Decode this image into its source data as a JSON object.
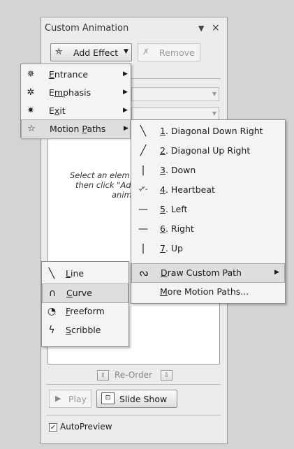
{
  "pane": {
    "title": "Custom Animation",
    "dropdown_glyph": "▼",
    "close_glyph": "×",
    "add_effect": {
      "label": "Add Effect",
      "icon": "add-effect-star-icon",
      "arrow": "▼"
    },
    "remove": {
      "label": "Remove",
      "icon": "remove-star-icon"
    },
    "list_hint": [
      "Select an elem",
      "then click \"Ad",
      "anim"
    ],
    "reorder": {
      "label": "Re-Order",
      "up_glyph": "⇧",
      "down_glyph": "⇩"
    },
    "play": {
      "label": "Play",
      "glyph": "▶"
    },
    "slide_show": {
      "label": "Slide Show",
      "glyph": "⊡"
    },
    "autopreview": {
      "label": "AutoPreview",
      "checked": true,
      "check_glyph": "✓"
    }
  },
  "effect_menu": {
    "items": [
      {
        "pre": "",
        "key": "E",
        "post": "ntrance",
        "icon": "✵"
      },
      {
        "pre": "E",
        "key": "m",
        "post": "phasis",
        "icon": "✲"
      },
      {
        "pre": "E",
        "key": "x",
        "post": "it",
        "icon": "✷"
      },
      {
        "pre": "Motion ",
        "key": "P",
        "post": "aths",
        "icon": "☆"
      }
    ],
    "submenu_arrow": "▶"
  },
  "motion_paths_menu": {
    "items": [
      {
        "key": "1",
        "rest": ". Diagonal Down Right",
        "icon": "╲"
      },
      {
        "key": "2",
        "rest": ". Diagonal Up Right",
        "icon": "╱"
      },
      {
        "key": "3",
        "rest": ". Down",
        "icon": "|"
      },
      {
        "key": "4",
        "rest": ". Heartbeat",
        "icon": "-⁄ᐟ-"
      },
      {
        "key": "5",
        "rest": ". Left",
        "icon": "—"
      },
      {
        "key": "6",
        "rest": ". Right",
        "icon": "—"
      },
      {
        "key": "7",
        "rest": ". Up",
        "icon": "|"
      },
      {
        "key": "D",
        "rest": "raw Custom Path",
        "icon": "ᔓ"
      },
      {
        "key": "M",
        "rest": "ore Motion Paths...",
        "icon": ""
      }
    ],
    "submenu_arrow": "▶"
  },
  "draw_custom_menu": {
    "items": [
      {
        "key": "L",
        "rest": "ine",
        "icon": "╲"
      },
      {
        "key": "C",
        "rest": "urve",
        "icon": "∩"
      },
      {
        "key": "F",
        "rest": "reeform",
        "icon": "◔"
      },
      {
        "key": "S",
        "rest": "cribble",
        "icon": "ϟ"
      }
    ]
  }
}
